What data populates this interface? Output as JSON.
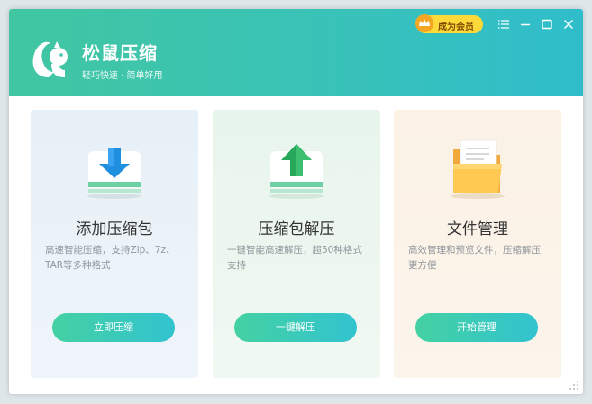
{
  "app": {
    "title": "松鼠压缩",
    "slogan": "轻巧快速 · 简单好用"
  },
  "header": {
    "vip_label": "成为会员",
    "controls": [
      "menu-icon",
      "minimize-icon",
      "maximize-icon",
      "close-icon"
    ]
  },
  "cards": [
    {
      "title": "添加压缩包",
      "description": "高速智能压缩，支持Zip、7z、TAR等多种格式",
      "button": "立即压缩",
      "icon": "download-arrow-drive-icon"
    },
    {
      "title": "压缩包解压",
      "description": "一键智能高速解压，超50种格式支持",
      "button": "一键解压",
      "icon": "upload-arrow-drive-icon"
    },
    {
      "title": "文件管理",
      "description": "高效管理和预览文件，压缩解压更方便",
      "button": "开始管理",
      "icon": "folder-icon"
    }
  ],
  "colors": {
    "accent_green": "#41c6a1",
    "accent_teal": "#2fbdcb",
    "vip_yellow": "#ffd93a"
  }
}
